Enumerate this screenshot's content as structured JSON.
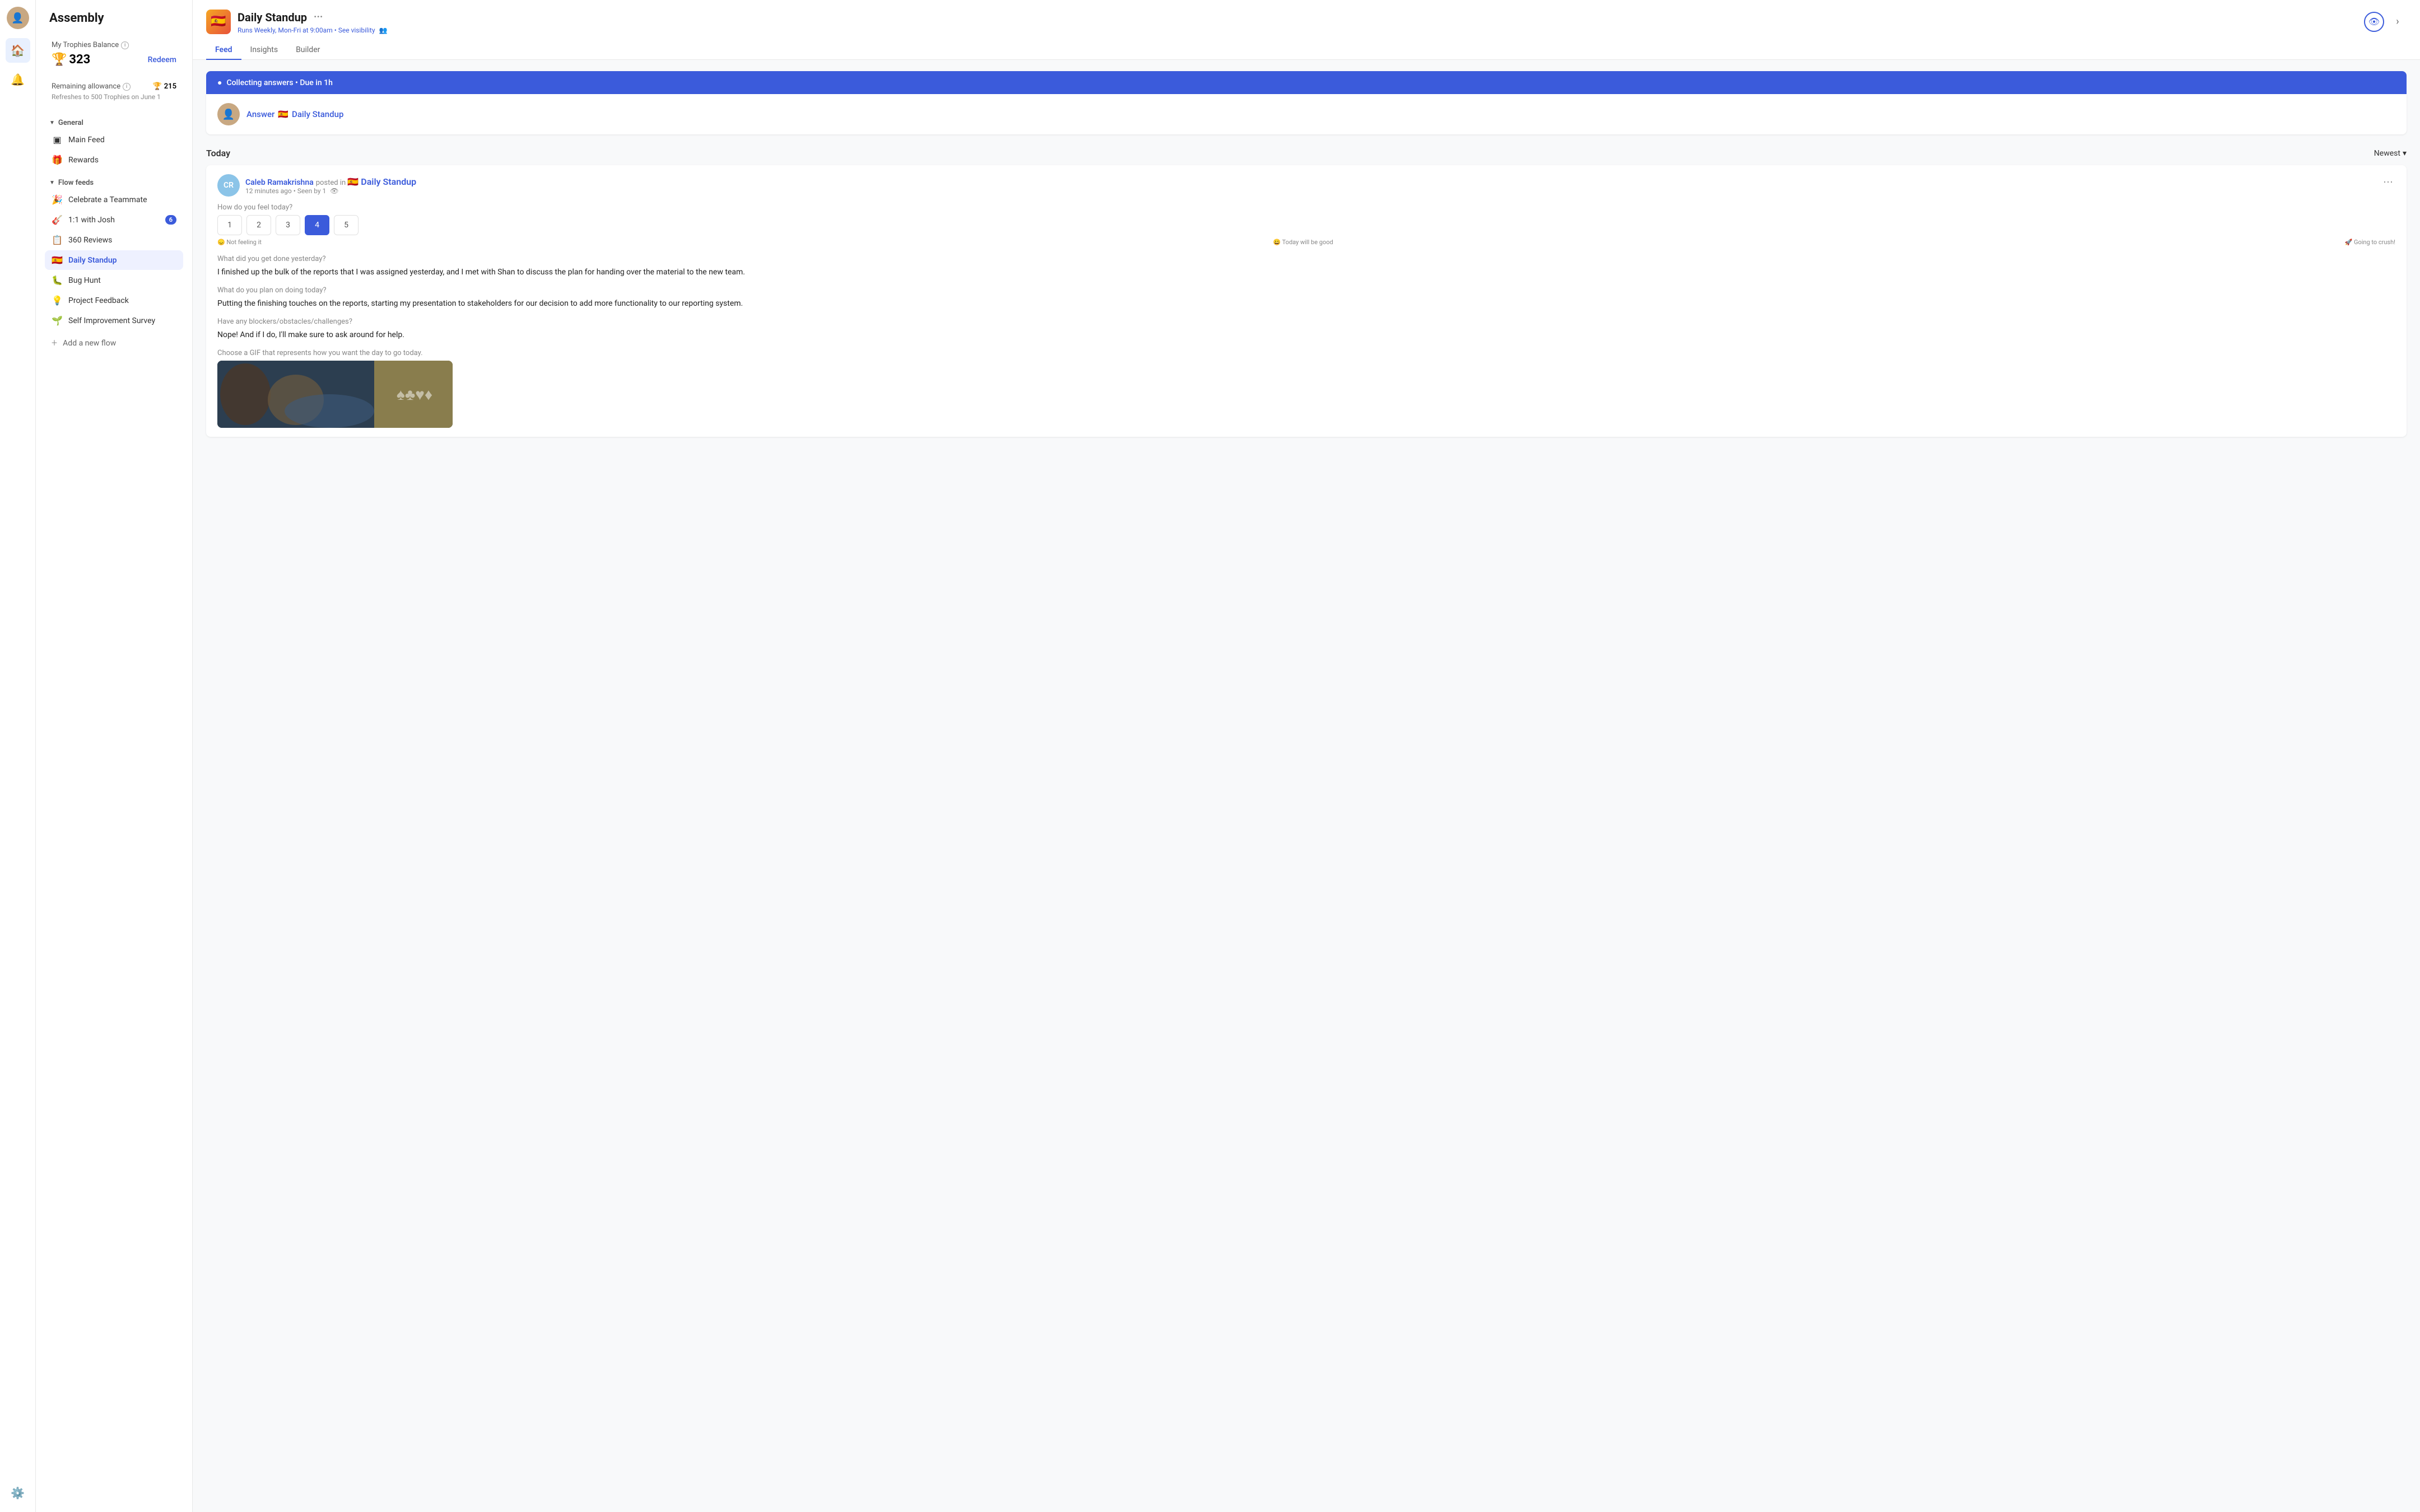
{
  "app": {
    "title": "Assembly"
  },
  "sidebar": {
    "title": "Assembly",
    "trophies": {
      "balance_label": "My Trophies Balance",
      "amount": "323",
      "redeem_label": "Redeem",
      "remaining_label": "Remaining allowance",
      "remaining_amount": "215",
      "refresh_text": "Refreshes to 500 Trophies on June 1"
    },
    "sections": [
      {
        "label": "General",
        "items": [
          {
            "id": "main-feed",
            "label": "Main Feed",
            "icon": "▣",
            "active": false
          },
          {
            "id": "rewards",
            "label": "Rewards",
            "icon": "🎁",
            "active": false
          }
        ]
      },
      {
        "label": "Flow feeds",
        "items": [
          {
            "id": "celebrate",
            "label": "Celebrate a Teammate",
            "icon": "🎉",
            "active": false
          },
          {
            "id": "1on1-josh",
            "label": "1:1 with Josh",
            "icon": "🎸",
            "active": false,
            "badge": "6"
          },
          {
            "id": "360-reviews",
            "label": "360 Reviews",
            "icon": "📋",
            "active": false
          },
          {
            "id": "daily-standup",
            "label": "Daily Standup",
            "icon": "🇪🇸",
            "active": true
          },
          {
            "id": "bug-hunt",
            "label": "Bug Hunt",
            "icon": "🐛",
            "active": false
          },
          {
            "id": "project-feedback",
            "label": "Project Feedback",
            "icon": "💡",
            "active": false
          },
          {
            "id": "self-improvement",
            "label": "Self Improvement Survey",
            "icon": "🌱",
            "active": false
          }
        ]
      }
    ],
    "add_flow_label": "Add a new flow"
  },
  "header": {
    "flow_title": "Daily Standup",
    "flow_dots": "···",
    "schedule_text": "Runs Weekly, Mon-Fri at 9:00am",
    "see_visibility_label": "See visibility",
    "tabs": [
      {
        "id": "feed",
        "label": "Feed",
        "active": true
      },
      {
        "id": "insights",
        "label": "Insights",
        "active": false
      },
      {
        "id": "builder",
        "label": "Builder",
        "active": false
      }
    ]
  },
  "feed": {
    "banner": {
      "text": "Collecting answers • Due in 1h"
    },
    "answer_prompt": {
      "text": "Answer",
      "flow_emoji": "🇪🇸",
      "flow_name": "Daily Standup"
    },
    "sort": {
      "today_label": "Today",
      "sort_label": "Newest"
    },
    "post": {
      "author_name": "Caleb Ramakrishna",
      "posted_in_text": "posted in",
      "flow_emoji": "🇪🇸",
      "flow_name": "Daily Standup",
      "time_ago": "12 minutes ago",
      "seen_text": "Seen by 1",
      "questions": [
        {
          "label": "How do you feel today?",
          "type": "rating",
          "ratings": [
            "1",
            "2",
            "3",
            "4",
            "5"
          ],
          "selected": 4,
          "scale_labels": {
            "left": "😞 Not feeling it",
            "middle": "😀 Today will be good",
            "right": "🚀 Going to crush!"
          }
        },
        {
          "label": "What did you get done yesterday?",
          "type": "text",
          "answer": "I finished up the bulk of the reports that I was assigned yesterday, and I met with Shan to discuss the plan for handing over the material to the new team."
        },
        {
          "label": "What do you plan on doing today?",
          "type": "text",
          "answer": "Putting the finishing touches on the reports, starting my presentation to stakeholders for our decision to add more functionality to our reporting system."
        },
        {
          "label": "Have any blockers/obstacles/challenges?",
          "type": "text",
          "answer": "Nope! And if I do, I'll make sure to ask around for help."
        },
        {
          "label": "Choose a GIF that represents how you want the day to go today.",
          "type": "gif"
        }
      ]
    }
  }
}
